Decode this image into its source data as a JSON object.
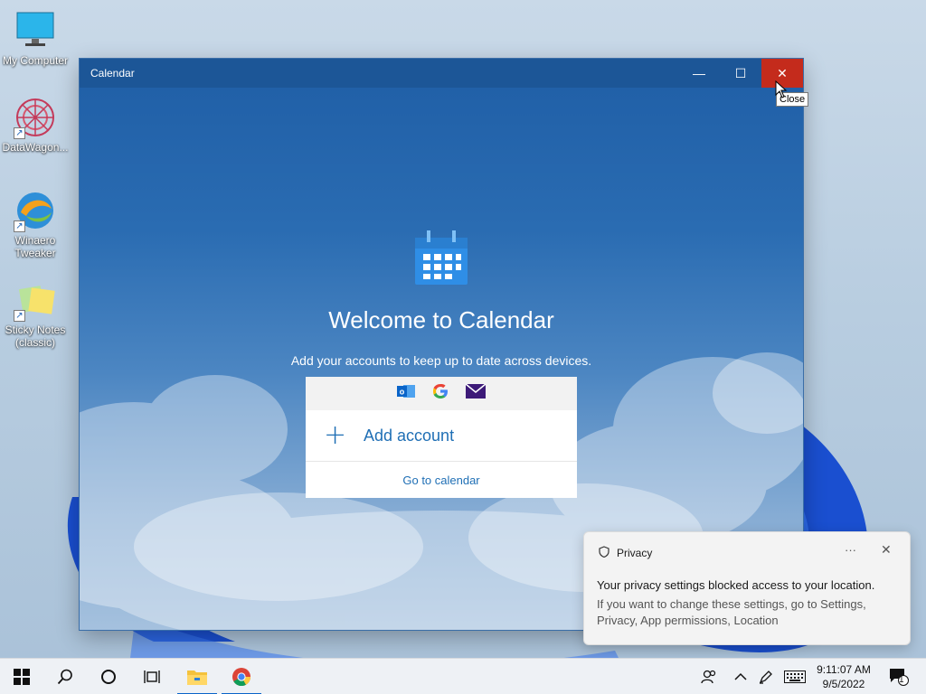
{
  "desktop": {
    "icons": [
      {
        "label": "My Computer",
        "icon": "monitor-icon"
      },
      {
        "label": "DataWagon...",
        "icon": "datawagon-icon"
      },
      {
        "label": "Winaero Tweaker",
        "icon": "winaero-tweaker-icon"
      },
      {
        "label": "Sticky Notes (classic)",
        "icon": "sticky-notes-icon"
      }
    ]
  },
  "window": {
    "title": "Calendar",
    "minimize_glyph": "—",
    "maximize_glyph": "☐",
    "close_glyph": "✕",
    "close_tooltip": "Close"
  },
  "calendar": {
    "welcome": "Welcome to Calendar",
    "subtitle": "Add your accounts to keep up to date across devices.",
    "providers": [
      "outlook-icon",
      "google-icon",
      "mail-icon"
    ],
    "add_account": "Add account",
    "add_glyph": "+",
    "go_to_calendar": "Go to calendar"
  },
  "notification": {
    "app": "Privacy",
    "more_glyph": "···",
    "close_glyph": "✕",
    "message": "Your privacy settings blocked access to your location.",
    "detail": "If you want to change these settings, go to Settings, Privacy, App permissions, Location"
  },
  "taskbar": {
    "time": "9:11:07 AM",
    "date": "9/5/2022",
    "notification_count": "1",
    "colors": {
      "accent": "#0a64c8",
      "close_red": "#c42b1c"
    }
  }
}
